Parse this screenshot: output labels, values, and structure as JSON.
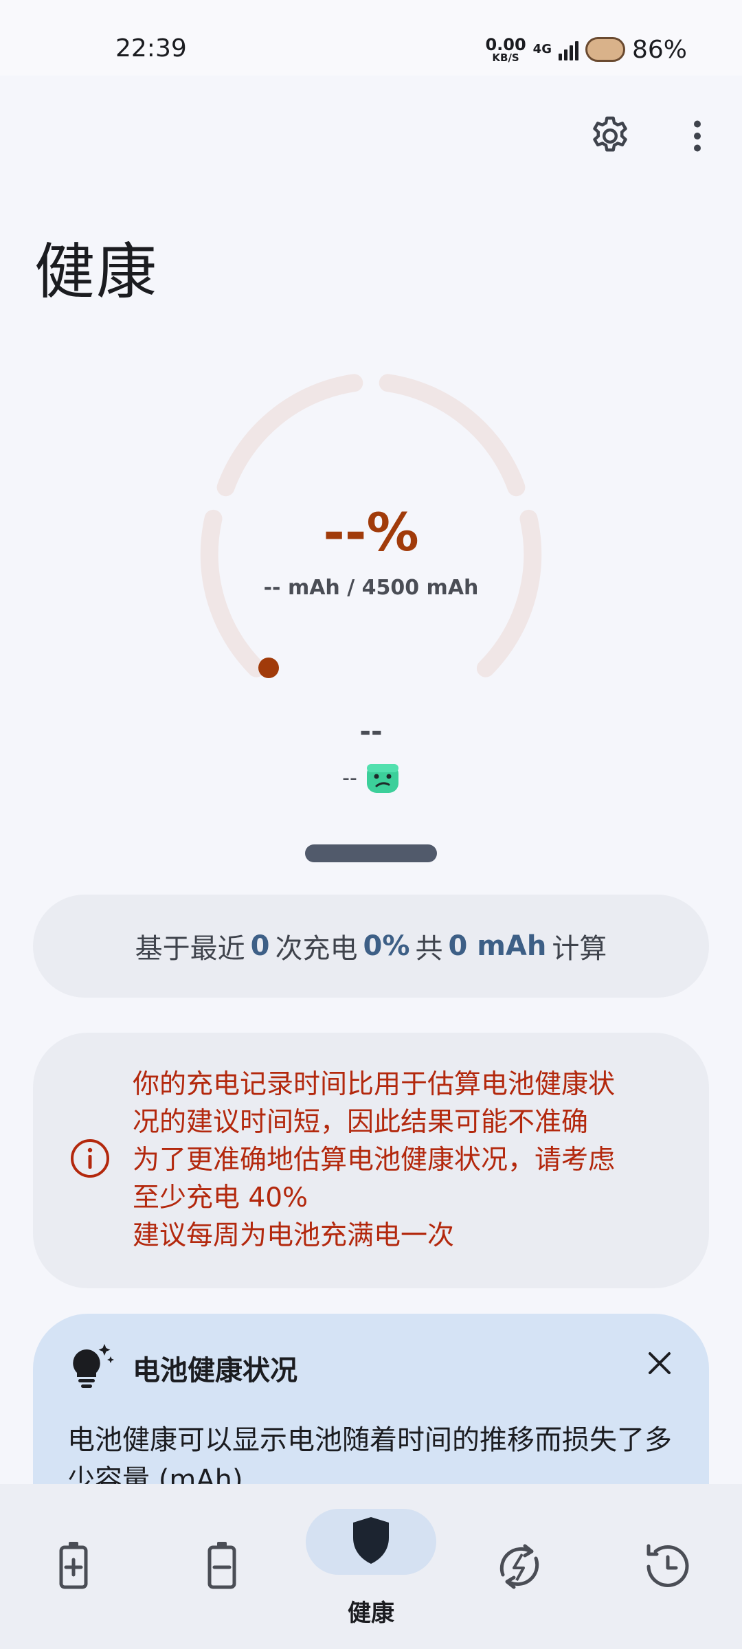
{
  "status_bar": {
    "time": "22:39",
    "net_speed": "0.00",
    "net_unit": "KB/S",
    "network": "4G",
    "battery": "86%"
  },
  "header": {
    "settings_icon": "gear-icon",
    "menu_icon": "more-vert-icon",
    "title": "健康"
  },
  "gauge": {
    "value": "--%",
    "capacity": "-- mAh / 4500 mAh",
    "progress_fraction": 0,
    "track_color": "#f0e6e6",
    "indicator_color": "#a13b0a"
  },
  "health_status": {
    "label": "--",
    "detail": "--",
    "face_icon": "sad-face-icon"
  },
  "summary": {
    "prefix": "基于最近",
    "charges": "0",
    "mid1": "次充电",
    "percent": "0%",
    "mid2": "共",
    "capacity": "0 mAh",
    "suffix": "计算"
  },
  "warning": {
    "icon": "info-icon",
    "lines": [
      "你的充电记录时间比用于估算电池健康状",
      "况的建议时间短，因此结果可能不准确",
      "为了更准确地估算电池健康状况，请考虑",
      "至少充电 40%",
      "建议每周为电池充满电一次"
    ]
  },
  "tip": {
    "icon": "lightbulb-sparkle-icon",
    "title": "电池健康状况",
    "close_icon": "close-icon",
    "body": "电池健康可以显示电池随着时间的推移而损失了多少容量 (mAh)"
  },
  "bottom_nav": {
    "items": [
      {
        "icon": "battery-charging-icon",
        "label": ""
      },
      {
        "icon": "battery-discharging-icon",
        "label": ""
      },
      {
        "icon": "shield-icon",
        "label": "健康"
      },
      {
        "icon": "charge-cycle-icon",
        "label": ""
      },
      {
        "icon": "history-icon",
        "label": ""
      }
    ],
    "active_label": "健康"
  },
  "colors": {
    "accent": "#a13b0a",
    "highlight": "#3d5f86",
    "warning": "#b3280d",
    "tip_bg": "#d5e3f5"
  }
}
